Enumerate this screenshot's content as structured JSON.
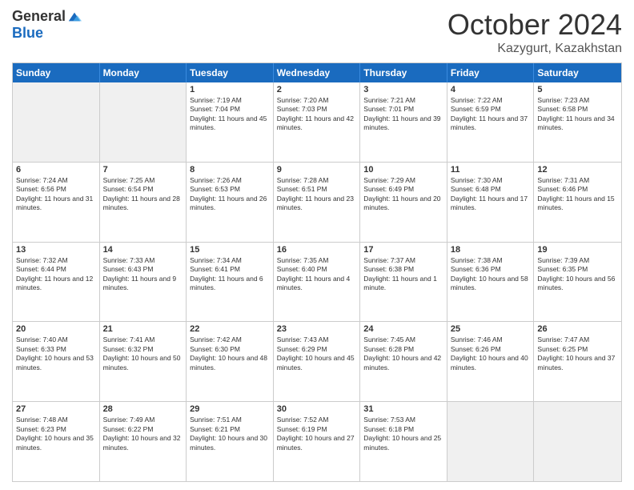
{
  "header": {
    "logo_general": "General",
    "logo_blue": "Blue",
    "title": "October 2024",
    "location": "Kazygurt, Kazakhstan"
  },
  "days_of_week": [
    "Sunday",
    "Monday",
    "Tuesday",
    "Wednesday",
    "Thursday",
    "Friday",
    "Saturday"
  ],
  "weeks": [
    {
      "cells": [
        {
          "day": "",
          "text": "",
          "shaded": true
        },
        {
          "day": "",
          "text": "",
          "shaded": true
        },
        {
          "day": "1",
          "text": "Sunrise: 7:19 AM\nSunset: 7:04 PM\nDaylight: 11 hours and 45 minutes."
        },
        {
          "day": "2",
          "text": "Sunrise: 7:20 AM\nSunset: 7:03 PM\nDaylight: 11 hours and 42 minutes."
        },
        {
          "day": "3",
          "text": "Sunrise: 7:21 AM\nSunset: 7:01 PM\nDaylight: 11 hours and 39 minutes."
        },
        {
          "day": "4",
          "text": "Sunrise: 7:22 AM\nSunset: 6:59 PM\nDaylight: 11 hours and 37 minutes."
        },
        {
          "day": "5",
          "text": "Sunrise: 7:23 AM\nSunset: 6:58 PM\nDaylight: 11 hours and 34 minutes."
        }
      ]
    },
    {
      "cells": [
        {
          "day": "6",
          "text": "Sunrise: 7:24 AM\nSunset: 6:56 PM\nDaylight: 11 hours and 31 minutes."
        },
        {
          "day": "7",
          "text": "Sunrise: 7:25 AM\nSunset: 6:54 PM\nDaylight: 11 hours and 28 minutes."
        },
        {
          "day": "8",
          "text": "Sunrise: 7:26 AM\nSunset: 6:53 PM\nDaylight: 11 hours and 26 minutes."
        },
        {
          "day": "9",
          "text": "Sunrise: 7:28 AM\nSunset: 6:51 PM\nDaylight: 11 hours and 23 minutes."
        },
        {
          "day": "10",
          "text": "Sunrise: 7:29 AM\nSunset: 6:49 PM\nDaylight: 11 hours and 20 minutes."
        },
        {
          "day": "11",
          "text": "Sunrise: 7:30 AM\nSunset: 6:48 PM\nDaylight: 11 hours and 17 minutes."
        },
        {
          "day": "12",
          "text": "Sunrise: 7:31 AM\nSunset: 6:46 PM\nDaylight: 11 hours and 15 minutes."
        }
      ]
    },
    {
      "cells": [
        {
          "day": "13",
          "text": "Sunrise: 7:32 AM\nSunset: 6:44 PM\nDaylight: 11 hours and 12 minutes."
        },
        {
          "day": "14",
          "text": "Sunrise: 7:33 AM\nSunset: 6:43 PM\nDaylight: 11 hours and 9 minutes."
        },
        {
          "day": "15",
          "text": "Sunrise: 7:34 AM\nSunset: 6:41 PM\nDaylight: 11 hours and 6 minutes."
        },
        {
          "day": "16",
          "text": "Sunrise: 7:35 AM\nSunset: 6:40 PM\nDaylight: 11 hours and 4 minutes."
        },
        {
          "day": "17",
          "text": "Sunrise: 7:37 AM\nSunset: 6:38 PM\nDaylight: 11 hours and 1 minute."
        },
        {
          "day": "18",
          "text": "Sunrise: 7:38 AM\nSunset: 6:36 PM\nDaylight: 10 hours and 58 minutes."
        },
        {
          "day": "19",
          "text": "Sunrise: 7:39 AM\nSunset: 6:35 PM\nDaylight: 10 hours and 56 minutes."
        }
      ]
    },
    {
      "cells": [
        {
          "day": "20",
          "text": "Sunrise: 7:40 AM\nSunset: 6:33 PM\nDaylight: 10 hours and 53 minutes."
        },
        {
          "day": "21",
          "text": "Sunrise: 7:41 AM\nSunset: 6:32 PM\nDaylight: 10 hours and 50 minutes."
        },
        {
          "day": "22",
          "text": "Sunrise: 7:42 AM\nSunset: 6:30 PM\nDaylight: 10 hours and 48 minutes."
        },
        {
          "day": "23",
          "text": "Sunrise: 7:43 AM\nSunset: 6:29 PM\nDaylight: 10 hours and 45 minutes."
        },
        {
          "day": "24",
          "text": "Sunrise: 7:45 AM\nSunset: 6:28 PM\nDaylight: 10 hours and 42 minutes."
        },
        {
          "day": "25",
          "text": "Sunrise: 7:46 AM\nSunset: 6:26 PM\nDaylight: 10 hours and 40 minutes."
        },
        {
          "day": "26",
          "text": "Sunrise: 7:47 AM\nSunset: 6:25 PM\nDaylight: 10 hours and 37 minutes."
        }
      ]
    },
    {
      "cells": [
        {
          "day": "27",
          "text": "Sunrise: 7:48 AM\nSunset: 6:23 PM\nDaylight: 10 hours and 35 minutes."
        },
        {
          "day": "28",
          "text": "Sunrise: 7:49 AM\nSunset: 6:22 PM\nDaylight: 10 hours and 32 minutes."
        },
        {
          "day": "29",
          "text": "Sunrise: 7:51 AM\nSunset: 6:21 PM\nDaylight: 10 hours and 30 minutes."
        },
        {
          "day": "30",
          "text": "Sunrise: 7:52 AM\nSunset: 6:19 PM\nDaylight: 10 hours and 27 minutes."
        },
        {
          "day": "31",
          "text": "Sunrise: 7:53 AM\nSunset: 6:18 PM\nDaylight: 10 hours and 25 minutes."
        },
        {
          "day": "",
          "text": "",
          "shaded": true
        },
        {
          "day": "",
          "text": "",
          "shaded": true
        }
      ]
    }
  ]
}
